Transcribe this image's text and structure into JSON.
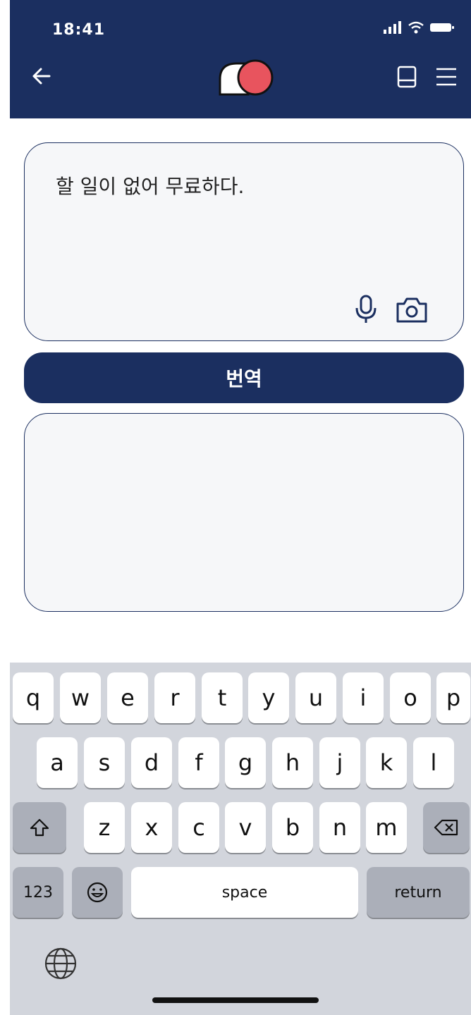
{
  "status_bar": {
    "time": "18:41"
  },
  "input": {
    "text": "할 일이 없어 무료하다."
  },
  "translate_button": {
    "label": "번역"
  },
  "output": {
    "text": ""
  },
  "keyboard": {
    "row1": [
      "q",
      "w",
      "e",
      "r",
      "t",
      "y",
      "u",
      "i",
      "o",
      "p"
    ],
    "row2": [
      "a",
      "s",
      "d",
      "f",
      "g",
      "h",
      "j",
      "k",
      "l"
    ],
    "row3": [
      "z",
      "x",
      "c",
      "v",
      "b",
      "n",
      "m"
    ],
    "numbers_label": "123",
    "space_label": "space",
    "return_label": "return"
  },
  "colors": {
    "header": "#1b2f60",
    "logo_red": "#e8545e",
    "box_background": "#f6f7f9",
    "keyboard_background": "#d2d5dc"
  }
}
